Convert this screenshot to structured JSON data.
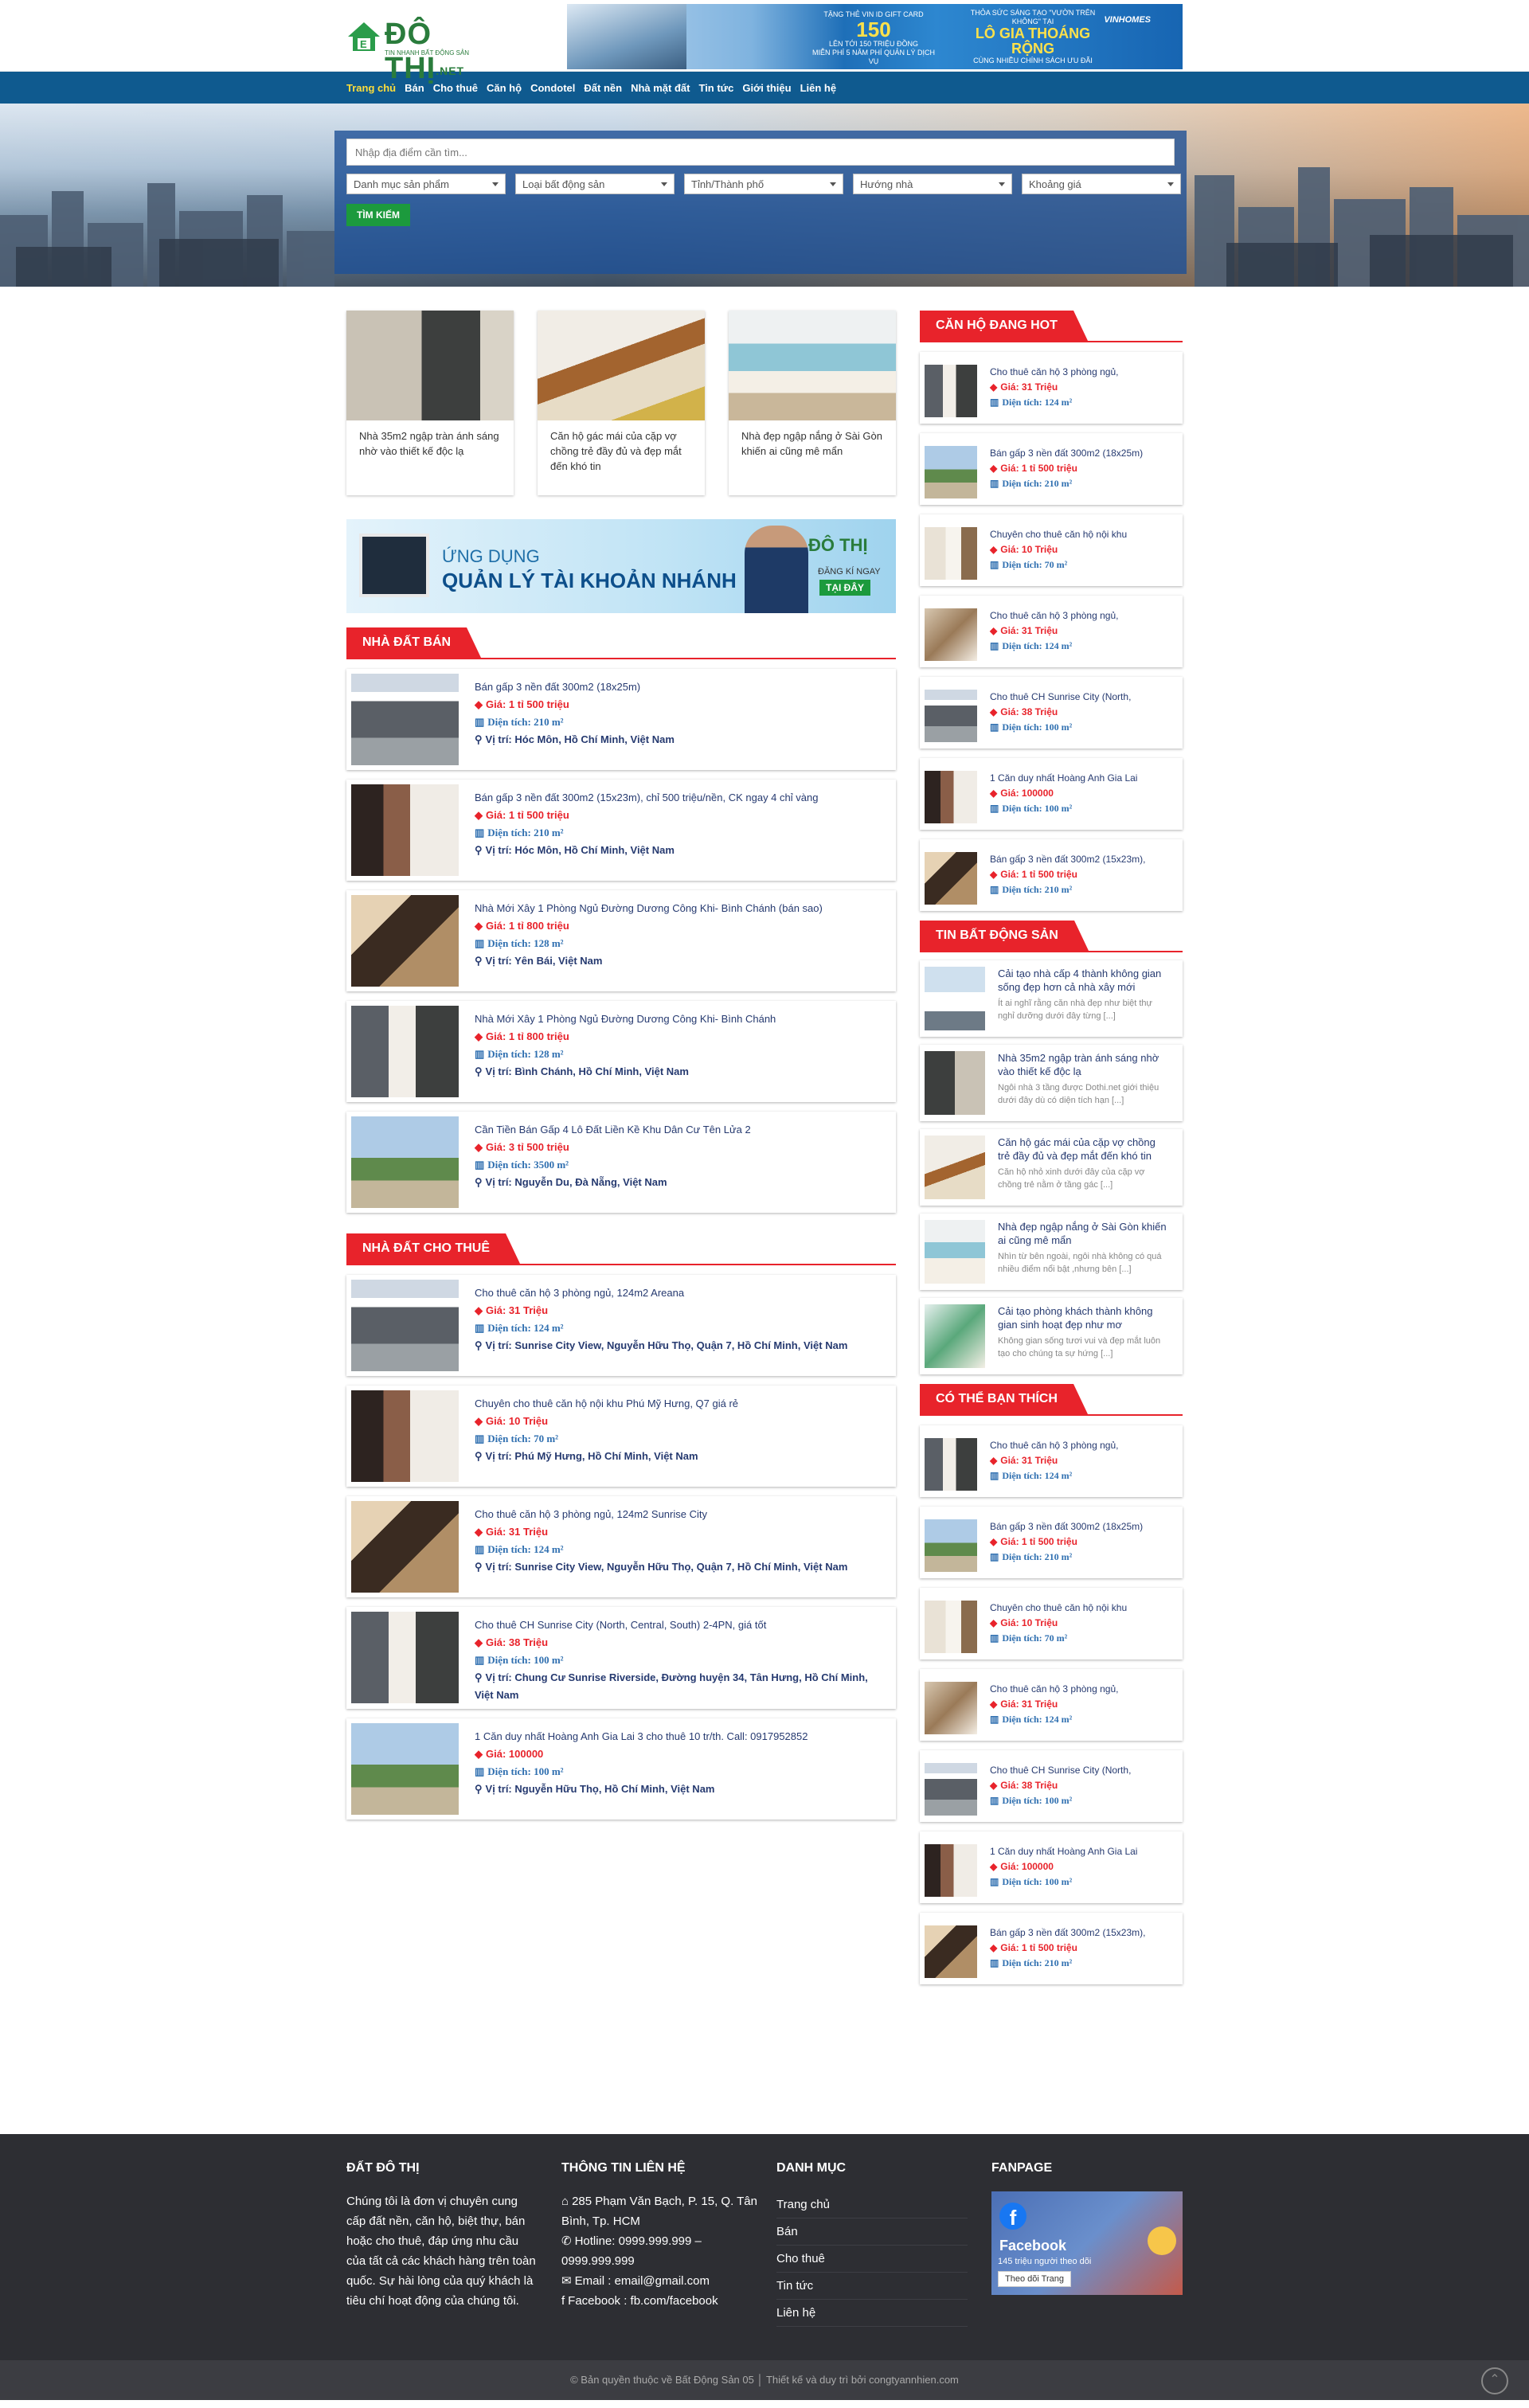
{
  "brand": {
    "name": "ĐÔ THỊ",
    "suffix": ".NET",
    "slogan": "TIN NHANH BẤT ĐỘNG SẢN"
  },
  "top_banner": {
    "line1": "TẶNG THẺ VIN ID GIFT CARD",
    "big1": "150",
    "line1b": "LÊN TỚI 150 TRIỆU ĐỒNG",
    "line1c": "MIỄN PHÍ 5 NĂM PHÍ QUẢN LÝ DỊCH VỤ",
    "line2": "THỎA SỨC SÁNG TẠO \"VƯỜN TRÊN KHÔNG\" TẠI",
    "big2": "LÔ GIA THOÁNG RỘNG",
    "line2b": "CÙNG NHIỀU CHÍNH SÁCH ƯU ĐÃI",
    "brand": "VINHOMES"
  },
  "nav": [
    "Trang chủ",
    "Bán",
    "Cho thuê",
    "Căn hộ",
    "Condotel",
    "Đất nền",
    "Nhà mặt đất",
    "Tin tức",
    "Giới thiệu",
    "Liên hệ"
  ],
  "search": {
    "placeholder": "Nhập địa điểm cần tìm...",
    "selects": [
      "Danh mục sản phẩm",
      "Loại bất động sản",
      "Tỉnh/Thành phố",
      "Hướng nhà",
      "Khoảng giá"
    ],
    "button": "TÌM KIẾM"
  },
  "featured": [
    "Nhà 35m2 ngập tràn ánh sáng nhờ vào thiết kế độc lạ",
    "Căn hộ gác mái của cặp vợ chồng trẻ đầy đủ và đẹp mắt đến khó tin",
    "Nhà đẹp ngập nắng ở Sài Gòn khiến ai cũng mê mẩn"
  ],
  "app_banner": {
    "t1": "ỨNG DỤNG",
    "t2": "QUẢN LÝ TÀI KHOẢN NHÁNH",
    "logo": "ĐÔ THỊ",
    "reg": "ĐĂNG KÍ NGAY",
    "here": "TẠI ĐÂY"
  },
  "sale": {
    "title": "NHÀ ĐẤT BÁN",
    "items": [
      {
        "title": "Bán gấp 3 nền đất 300m2 (18x25m)",
        "price": "Giá: 1 tỉ 500 triệu",
        "area": "Diện tích: 210 m²",
        "loc": "Vị trí: Hóc Môn, Hồ Chí Minh, Việt Nam"
      },
      {
        "title": "Bán gấp 3 nền đất 300m2 (15x23m), chỉ 500 triệu/nền, CK ngay 4 chỉ vàng",
        "price": "Giá: 1 tỉ 500 triệu",
        "area": "Diện tích: 210 m²",
        "loc": "Vị trí: Hóc Môn, Hồ Chí Minh, Việt Nam"
      },
      {
        "title": "Nhà Mới Xây 1 Phòng Ngủ Đường Dương Công Khi- Bình Chánh (bán sao)",
        "price": "Giá: 1 tỉ 800 triệu",
        "area": "Diện tích: 128 m²",
        "loc": "Vị trí: Yên Bái, Việt Nam"
      },
      {
        "title": "Nhà Mới Xây 1 Phòng Ngủ Đường Dương Công Khi- Bình Chánh",
        "price": "Giá: 1 tỉ 800 triệu",
        "area": "Diện tích: 128 m²",
        "loc": "Vị trí: Bình Chánh, Hồ Chí Minh, Việt Nam"
      },
      {
        "title": "Cần Tiền Bán Gấp 4 Lô Đất Liền Kề Khu Dân Cư Tên Lửa 2",
        "price": "Giá: 3 tỉ 500 triệu",
        "area": "Diện tích: 3500 m²",
        "loc": "Vị trí: Nguyễn Du, Đà Nẵng, Việt Nam"
      }
    ]
  },
  "rent": {
    "title": "NHÀ ĐẤT CHO THUÊ",
    "items": [
      {
        "title": "Cho thuê căn hộ 3 phòng ngủ, 124m2 Areana",
        "price": "Giá: 31 Triệu",
        "area": "Diện tích: 124 m²",
        "loc": "Vị trí: Sunrise City View, Nguyễn Hữu Thọ, Quận 7, Hồ Chí Minh, Việt Nam"
      },
      {
        "title": "Chuyên cho thuê căn hộ nội khu Phú Mỹ Hưng, Q7 giá rẻ",
        "price": "Giá: 10 Triệu",
        "area": "Diện tích: 70 m²",
        "loc": "Vị trí: Phú Mỹ Hưng, Hồ Chí Minh, Việt Nam"
      },
      {
        "title": "Cho thuê căn hộ 3 phòng ngủ, 124m2 Sunrise City",
        "price": "Giá: 31 Triệu",
        "area": "Diện tích: 124 m²",
        "loc": "Vị trí: Sunrise City View, Nguyễn Hữu Thọ, Quận 7, Hồ Chí Minh, Việt Nam"
      },
      {
        "title": "Cho thuê CH Sunrise City (North, Central, South) 2-4PN, giá tốt",
        "price": "Giá: 38 Triệu",
        "area": "Diện tích: 100 m²",
        "loc": "Vị trí: Chung Cư Sunrise Riverside, Đường huyện 34, Tân Hưng, Hồ Chí Minh, Việt Nam"
      },
      {
        "title": "1 Căn duy nhất Hoàng Anh Gia Lai 3 cho thuê 10 tr/th. Call: 0917952852",
        "price": "Giá: 100000",
        "area": "Diện tích: 100 m²",
        "loc": "Vị trí: Nguyễn Hữu Thọ, Hồ Chí Minh, Việt Nam"
      }
    ]
  },
  "hot": {
    "title": "CĂN HỘ ĐANG HOT",
    "items": [
      {
        "title": "Cho thuê căn hộ 3 phòng ngủ,",
        "price": "Giá: 31 Triệu",
        "area": "Diện tích: 124 m²"
      },
      {
        "title": "Bán gấp 3 nền đất 300m2 (18x25m)",
        "price": "Giá: 1 tỉ 500 triệu",
        "area": "Diện tích: 210 m²"
      },
      {
        "title": "Chuyên cho thuê căn hộ nội khu",
        "price": "Giá: 10 Triệu",
        "area": "Diện tích: 70 m²"
      },
      {
        "title": "Cho thuê căn hộ 3 phòng ngủ,",
        "price": "Giá: 31 Triệu",
        "area": "Diện tích: 124 m²"
      },
      {
        "title": "Cho thuê CH Sunrise City (North,",
        "price": "Giá: 38 Triệu",
        "area": "Diện tích: 100 m²"
      },
      {
        "title": "1 Căn duy nhất Hoàng Anh Gia Lai",
        "price": "Giá: 100000",
        "area": "Diện tích: 100 m²"
      },
      {
        "title": "Bán gấp 3 nền đất 300m2 (15x23m),",
        "price": "Giá: 1 tỉ 500 triệu",
        "area": "Diện tích: 210 m²"
      }
    ]
  },
  "news": {
    "title": "TIN BẤT ĐỘNG SẢN",
    "items": [
      {
        "title": "Cải tạo nhà cấp 4 thành không gian sống đẹp hơn cả nhà xây mới",
        "desc": "Ít ai nghĩ rằng căn nhà đẹp như biệt thự nghỉ dưỡng dưới đây từng [...]"
      },
      {
        "title": "Nhà 35m2 ngập tràn ánh sáng nhờ vào thiết kế độc lạ",
        "desc": "Ngôi nhà 3 tầng được Dothi.net giới thiệu dưới đây dù có diện tích hạn [...]"
      },
      {
        "title": "Căn hộ gác mái của cặp vợ chồng trẻ đầy đủ và đẹp mắt đến khó tin",
        "desc": "Căn hộ nhỏ xinh dưới đây của cặp vợ chồng trẻ nằm ở tầng gác [...]"
      },
      {
        "title": "Nhà đẹp ngập nắng ở Sài Gòn khiến ai cũng mê mẩn",
        "desc": "Nhìn từ bên ngoài, ngôi nhà không có quá nhiều điểm nổi bật ,nhưng bên [...]"
      },
      {
        "title": "Cải tạo phòng khách thành không gian sinh hoạt đẹp như mơ",
        "desc": "Không gian sống tươi vui và đẹp mắt luôn tạo cho chúng ta sự hứng [...]"
      }
    ]
  },
  "maybe": {
    "title": "CÓ THỂ BẠN THÍCH",
    "items": [
      {
        "title": "Cho thuê căn hộ 3 phòng ngủ,",
        "price": "Giá: 31 Triệu",
        "area": "Diện tích: 124 m²"
      },
      {
        "title": "Bán gấp 3 nền đất 300m2 (18x25m)",
        "price": "Giá: 1 tỉ 500 triệu",
        "area": "Diện tích: 210 m²"
      },
      {
        "title": "Chuyên cho thuê căn hộ nội khu",
        "price": "Giá: 10 Triệu",
        "area": "Diện tích: 70 m²"
      },
      {
        "title": "Cho thuê căn hộ 3 phòng ngủ,",
        "price": "Giá: 31 Triệu",
        "area": "Diện tích: 124 m²"
      },
      {
        "title": "Cho thuê CH Sunrise City (North,",
        "price": "Giá: 38 Triệu",
        "area": "Diện tích: 100 m²"
      },
      {
        "title": "1 Căn duy nhất Hoàng Anh Gia Lai",
        "price": "Giá: 100000",
        "area": "Diện tích: 100 m²"
      },
      {
        "title": "Bán gấp 3 nền đất 300m2 (15x23m),",
        "price": "Giá: 1 tỉ 500 triệu",
        "area": "Diện tích: 210 m²"
      }
    ]
  },
  "footer": {
    "about_title": "ĐẤT ĐÔ THỊ",
    "about": "Chúng tôi là đơn vị chuyên cung cấp đất nền, căn hộ, biệt thự, bán hoặc cho thuê, đáp ứng nhu cầu của tất cả các khách hàng trên toàn quốc. Sự hài lòng của quý khách là tiêu chí hoạt động của chúng tôi.",
    "contact_title": "THÔNG TIN LIÊN HỆ",
    "address": "285 Phạm Văn Bạch, P. 15, Q. Tân Bình, Tp. HCM",
    "hotline": "Hotline: 0999.999.999 – 0999.999.999",
    "email": "Email : email@gmail.com",
    "facebook": "Facebook : fb.com/facebook",
    "menu_title": "DANH MỤC",
    "menu": [
      "Trang chủ",
      "Bán",
      "Cho thuê",
      "Tin tức",
      "Liên hệ"
    ],
    "fan_title": "FANPAGE",
    "fan_name": "Facebook",
    "fan_count": "145 triệu người theo dõi",
    "fan_button": "Theo dõi Trang",
    "copyright": "© Bản quyền thuộc về Bất Động Sản 05 │ Thiết kế và duy trì bởi congtyannhien.com"
  },
  "colors": {
    "nav": "#0f5a8f",
    "accent": "#e8232b",
    "green": "#1c9a3d",
    "footer": "#2d2e33"
  }
}
